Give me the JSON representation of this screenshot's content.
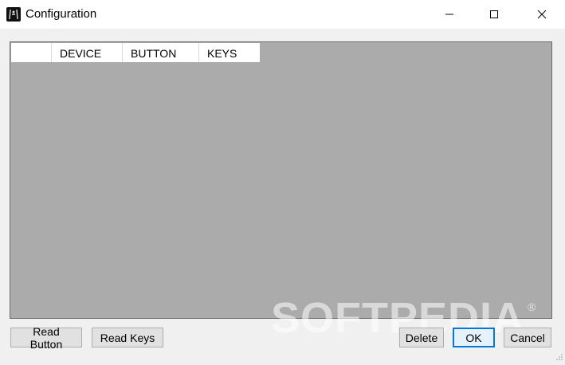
{
  "window": {
    "title": "Configuration",
    "app_icon": "gamepad-logo-icon",
    "controls": [
      "minimize-icon",
      "maximize-icon",
      "close-icon"
    ]
  },
  "grid": {
    "columns": [
      "DEVICE",
      "BUTTON",
      "KEYS"
    ],
    "rows": []
  },
  "watermark": {
    "text": "SOFTPEDIA",
    "mark": "®"
  },
  "buttons": {
    "read_button": "Read Button",
    "read_keys": "Read Keys",
    "delete": "Delete",
    "ok": "OK",
    "cancel": "Cancel"
  },
  "colors": {
    "grid_background": "#ababab",
    "focus_border": "#0078d7"
  }
}
